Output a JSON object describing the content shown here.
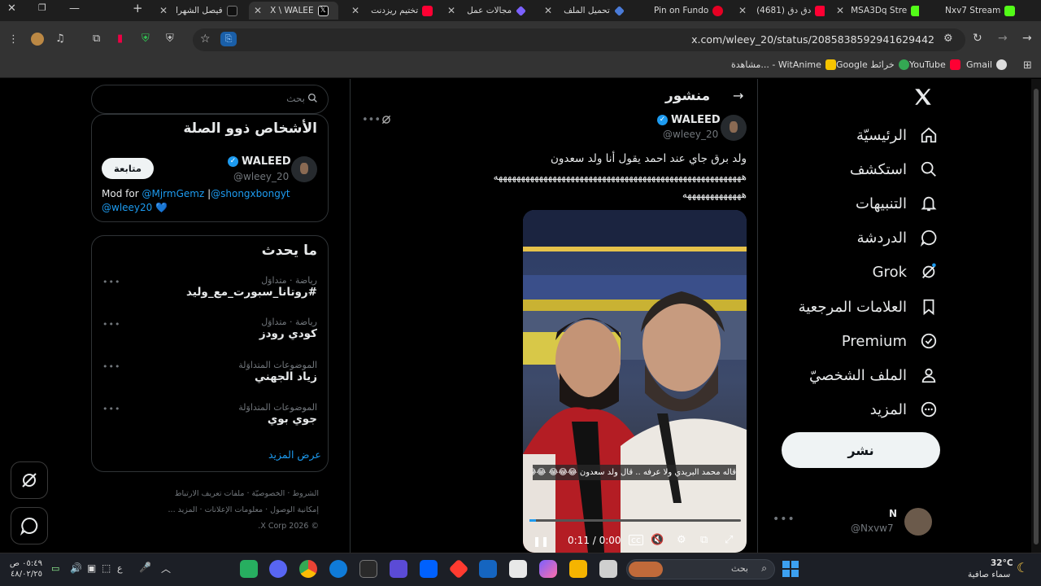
{
  "browser": {
    "tabs": [
      {
        "label": "فيصل الشهرا",
        "color": "#000000"
      },
      {
        "label": "X \\ WALEE",
        "color": "#000000"
      },
      {
        "label": "تختيم ريزدنت",
        "color": "#ff0033"
      },
      {
        "label": "مجالات عمل",
        "color": "#7b61ff"
      },
      {
        "label": "تحميل الملف",
        "color": "#4a7bd8"
      },
      {
        "label": "Pin on Fundo",
        "color": "#e60023"
      },
      {
        "label": "(4681) دق دق",
        "color": "#ff0033"
      },
      {
        "label": "MSA3Dq Stre",
        "color": "#53fc18"
      },
      {
        "label": "Nxv7 Stream",
        "color": "#53fc18"
      }
    ],
    "url": "x.com/wleey_20/status/2085838592941629442",
    "bookmarks": [
      {
        "label": "Gmail",
        "color": "#dddddd"
      },
      {
        "label": "YouTube",
        "color": "#ff0033"
      },
      {
        "label": "Google خرائط",
        "color": "#34a853"
      },
      {
        "label": "مشاهدة... - WitAnime",
        "color": "#f5c400"
      }
    ]
  },
  "nav": {
    "items": [
      {
        "label": "الرئيسيّة",
        "icon": "home-icon"
      },
      {
        "label": "استكشف",
        "icon": "search-icon"
      },
      {
        "label": "التنبيهات",
        "icon": "bell-icon"
      },
      {
        "label": "الدردشة",
        "icon": "chat-icon"
      },
      {
        "label": "Grok",
        "icon": "grok-icon"
      },
      {
        "label": "العلامات المرجعية",
        "icon": "bookmark-icon"
      },
      {
        "label": "Premium",
        "icon": "verified-icon"
      },
      {
        "label": "الملف الشخصيّ",
        "icon": "person-icon"
      },
      {
        "label": "المزيد",
        "icon": "more-circle-icon"
      }
    ],
    "post_button": "نشر",
    "account": {
      "name": "N",
      "handle": "@Nxvw7"
    }
  },
  "post": {
    "header_title": "منشور",
    "author_name": "WALEED",
    "author_handle": "@wleey_20",
    "text_line1": "ولد برق جاي عند احمد يقول أنا ولد سعدون",
    "text_line2": "هههههههههههههههههههههههههههههههههههههههههههههههههههههههه",
    "text_line3": "هههههههههههههه",
    "video_caption": "قاله محمد البريدي ولا عرفه .. قال ولد سعدون 😂😂😂 😂😂😂",
    "video_time": "0:11 / 0:00"
  },
  "sidebar": {
    "search_placeholder": "بحث",
    "related_title": "الأشخاص ذوو الصلة",
    "related_name": "WALEED",
    "related_handle": "@wleey_20",
    "follow_button": "متابعة",
    "bio_prefix": "Mod for",
    "bio_link1": "@MjrmGemz",
    "bio_sep": "|",
    "bio_link2": "@shongxbongyt",
    "bio_link3": "@wleey20",
    "bio_heart": "💙",
    "trends_title": "ما يحدث",
    "trends": [
      {
        "meta": "رياضة · متداوَل",
        "name": "#روتانا_سبورت_مع_وليد"
      },
      {
        "meta": "رياضة · متداوَل",
        "name": "كودي رودز"
      },
      {
        "meta": "الموضوعات المتداوَلة",
        "name": "زياد الجهني"
      },
      {
        "meta": "الموضوعات المتداوَلة",
        "name": "جوي بوي"
      }
    ],
    "show_more": "عرض المزيد",
    "footer_line1": "الشروط · الخصوصيّة · ملفات تعريف الارتباط",
    "footer_line2": "إمكانية الوصول · معلومات الإعلانات · المزيد ...",
    "footer_line3": "© 2026 X Corp."
  },
  "taskbar": {
    "search_placeholder": "بحث",
    "weather_temp": "32°C",
    "weather_desc": "سماء صافية",
    "clock_time": "٠٥:٤٩ ص",
    "clock_date": "٤٨/٠٢/٢٥",
    "lang": "ع"
  }
}
